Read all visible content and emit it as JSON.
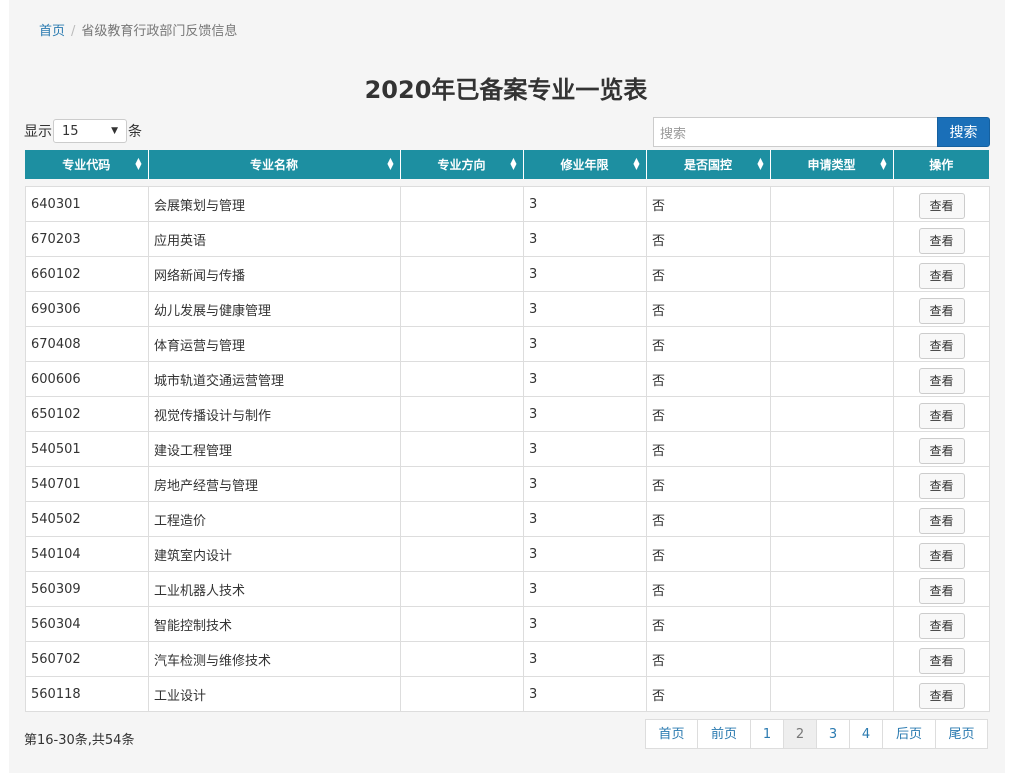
{
  "breadcrumb": {
    "home": "首页",
    "separator": "/",
    "current": "省级教育行政部门反馈信息"
  },
  "title": "2020年已备案专业一览表",
  "page_size": {
    "prefix": "显示",
    "value": "15",
    "suffix": "条"
  },
  "search": {
    "placeholder": "搜索",
    "button": "搜索"
  },
  "columns": [
    "专业代码",
    "专业名称",
    "专业方向",
    "修业年限",
    "是否国控",
    "申请类型",
    "操作"
  ],
  "rows": [
    {
      "code": "640301",
      "name": "会展策划与管理",
      "direction": "",
      "years": "3",
      "controlled": "否",
      "type": "",
      "action": "查看"
    },
    {
      "code": "670203",
      "name": "应用英语",
      "direction": "",
      "years": "3",
      "controlled": "否",
      "type": "",
      "action": "查看"
    },
    {
      "code": "660102",
      "name": "网络新闻与传播",
      "direction": "",
      "years": "3",
      "controlled": "否",
      "type": "",
      "action": "查看"
    },
    {
      "code": "690306",
      "name": "幼儿发展与健康管理",
      "direction": "",
      "years": "3",
      "controlled": "否",
      "type": "",
      "action": "查看"
    },
    {
      "code": "670408",
      "name": "体育运营与管理",
      "direction": "",
      "years": "3",
      "controlled": "否",
      "type": "",
      "action": "查看"
    },
    {
      "code": "600606",
      "name": "城市轨道交通运营管理",
      "direction": "",
      "years": "3",
      "controlled": "否",
      "type": "",
      "action": "查看"
    },
    {
      "code": "650102",
      "name": "视觉传播设计与制作",
      "direction": "",
      "years": "3",
      "controlled": "否",
      "type": "",
      "action": "查看"
    },
    {
      "code": "540501",
      "name": "建设工程管理",
      "direction": "",
      "years": "3",
      "controlled": "否",
      "type": "",
      "action": "查看"
    },
    {
      "code": "540701",
      "name": "房地产经营与管理",
      "direction": "",
      "years": "3",
      "controlled": "否",
      "type": "",
      "action": "查看"
    },
    {
      "code": "540502",
      "name": "工程造价",
      "direction": "",
      "years": "3",
      "controlled": "否",
      "type": "",
      "action": "查看"
    },
    {
      "code": "540104",
      "name": "建筑室内设计",
      "direction": "",
      "years": "3",
      "controlled": "否",
      "type": "",
      "action": "查看"
    },
    {
      "code": "560309",
      "name": "工业机器人技术",
      "direction": "",
      "years": "3",
      "controlled": "否",
      "type": "",
      "action": "查看"
    },
    {
      "code": "560304",
      "name": "智能控制技术",
      "direction": "",
      "years": "3",
      "controlled": "否",
      "type": "",
      "action": "查看"
    },
    {
      "code": "560702",
      "name": "汽车检测与维修技术",
      "direction": "",
      "years": "3",
      "controlled": "否",
      "type": "",
      "action": "查看"
    },
    {
      "code": "560118",
      "name": "工业设计",
      "direction": "",
      "years": "3",
      "controlled": "否",
      "type": "",
      "action": "查看"
    }
  ],
  "footer": {
    "summary": "第16-30条,共54条"
  },
  "pagination": [
    {
      "label": "首页",
      "active": false
    },
    {
      "label": "前页",
      "active": false
    },
    {
      "label": "1",
      "active": false
    },
    {
      "label": "2",
      "active": true
    },
    {
      "label": "3",
      "active": false
    },
    {
      "label": "4",
      "active": false
    },
    {
      "label": "后页",
      "active": false
    },
    {
      "label": "尾页",
      "active": false
    }
  ],
  "colors": {
    "header_bg": "#1d8fa1",
    "link": "#2a7ab0",
    "search_button": "#1a6fb8",
    "panel_bg": "#f5f5f5"
  }
}
